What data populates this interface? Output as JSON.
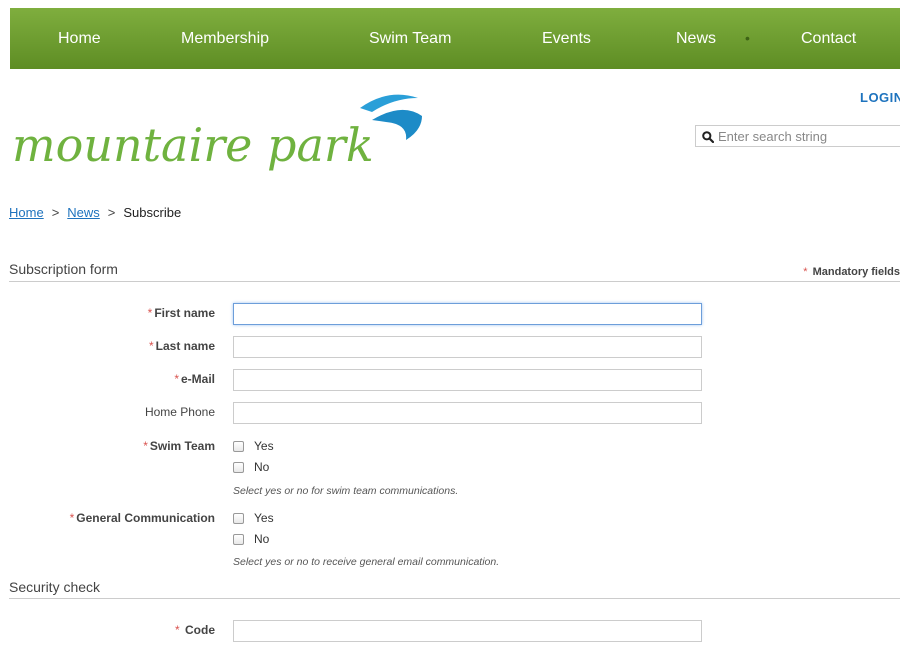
{
  "nav": {
    "items": [
      "Home",
      "Membership",
      "Swim Team",
      "Events",
      "News",
      "Contact"
    ],
    "separator": "•"
  },
  "logo": {
    "text": "mountaire park"
  },
  "header": {
    "login": "LOGIN",
    "search_placeholder": "Enter search string"
  },
  "breadcrumb": {
    "home": "Home",
    "news": "News",
    "current": "Subscribe",
    "separator": ">"
  },
  "form": {
    "section_title": "Subscription form",
    "mandatory_star": "*",
    "mandatory_label": "Mandatory fields",
    "fields": {
      "first_name": "First name",
      "last_name": "Last name",
      "email": "e-Mail",
      "home_phone": "Home Phone",
      "swim_team": "Swim Team",
      "general": "General Communication"
    },
    "options": {
      "yes": "Yes",
      "no": "No"
    },
    "hints": {
      "swim_team": "Select yes or no for swim team communications.",
      "general": "Select yes or no to receive general email communication."
    }
  },
  "security": {
    "section_title": "Security check",
    "code_label": "Code"
  },
  "colors": {
    "nav_green": "#6b9b2e",
    "link_blue": "#1e73be",
    "required_red": "#d9534f",
    "logo_green": "#6fb23f",
    "logo_blue": "#2a9fd8"
  },
  "icons": {
    "search": "magnifier-icon"
  }
}
